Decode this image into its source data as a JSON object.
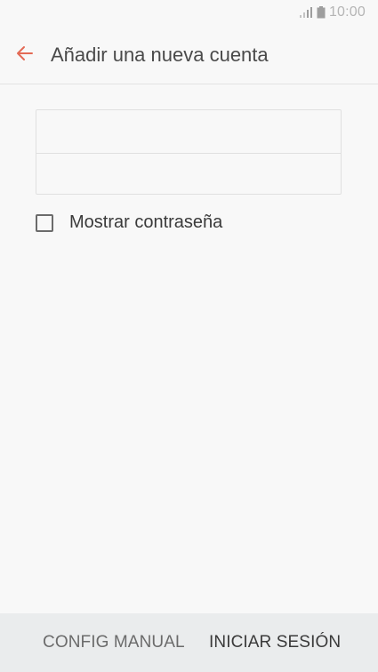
{
  "status_bar": {
    "time": "10:00",
    "signal_icon": "signal-icon",
    "battery_icon": "battery-icon",
    "icon_color": "#b5b5b5"
  },
  "app_bar": {
    "title": "Añadir una nueva cuenta",
    "back_icon": "arrow-left-icon",
    "accent_color": "#e36a55"
  },
  "form": {
    "email": {
      "value": "",
      "placeholder": ""
    },
    "password": {
      "value": "",
      "placeholder": ""
    },
    "show_password_label": "Mostrar contraseña",
    "show_password_checked": false
  },
  "bottom_bar": {
    "manual_label": "CONFIG MANUAL",
    "signin_label": "INICIAR SESIÓN"
  }
}
